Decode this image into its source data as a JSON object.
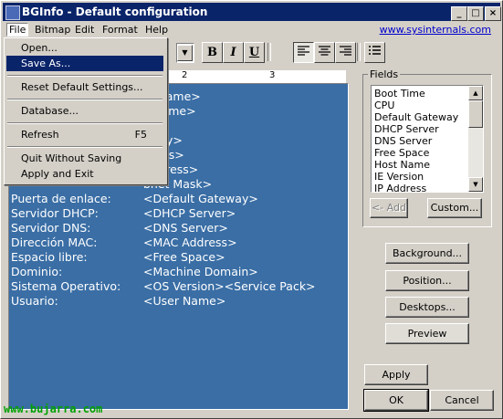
{
  "window": {
    "title": "BGInfo - Default configuration",
    "minimize_glyph": "_",
    "maximize_glyph": "□",
    "close_glyph": "×"
  },
  "menubar": {
    "items": [
      "File",
      "Bitmap",
      "Edit",
      "Format",
      "Help"
    ],
    "link": "www.sysinternals.com"
  },
  "file_menu": {
    "items": [
      {
        "label": "Open...",
        "shortcut": ""
      },
      {
        "label": "Save As...",
        "shortcut": ""
      },
      {
        "label": "Reset Default Settings...",
        "shortcut": ""
      },
      {
        "label": "Database...",
        "shortcut": ""
      },
      {
        "label": "Refresh",
        "shortcut": "F5"
      },
      {
        "label": "Quit Without Saving",
        "shortcut": ""
      },
      {
        "label": "Apply and Exit",
        "shortcut": ""
      }
    ]
  },
  "toolbar": {
    "bold": "B",
    "italic": "I",
    "underline": "U",
    "icons": [
      "align-left-icon",
      "align-center-icon",
      "align-right-icon",
      "bullet-list-icon"
    ]
  },
  "ruler": {
    "marks": [
      "2",
      "3"
    ]
  },
  "editor": {
    "lines": [
      {
        "label": "",
        "value": "st Name>"
      },
      {
        "label": "",
        "value": "ot Time>"
      },
      {
        "label": "",
        "value": "U>"
      },
      {
        "label": "",
        "value": "mory>"
      },
      {
        "label": "",
        "value": "umes>"
      },
      {
        "label": "",
        "value": "Address>"
      },
      {
        "label": "",
        "value": "bnet Mask>"
      },
      {
        "label": "Puerta de enlace:",
        "value": "<Default Gateway>"
      },
      {
        "label": "Servidor DHCP:",
        "value": "<DHCP Server>"
      },
      {
        "label": "Servidor DNS:",
        "value": "<DNS Server>"
      },
      {
        "label": "Dirección MAC:",
        "value": "<MAC Address>"
      },
      {
        "label": "Espacio libre:",
        "value": "<Free Space>"
      },
      {
        "label": "Dominio:",
        "value": "<Machine Domain>"
      },
      {
        "label": "Sistema Operativo:",
        "value": "<OS Version><Service Pack>"
      },
      {
        "label": "Usuario:",
        "value": "<User Name>"
      }
    ],
    "background": "#3a6ea5"
  },
  "fields": {
    "label": "Fields",
    "items": [
      "Boot Time",
      "CPU",
      "Default Gateway",
      "DHCP Server",
      "DNS Server",
      "Free Space",
      "Host Name",
      "IE Version",
      "IP Address"
    ],
    "add_button": "<- Add",
    "custom_button": "Custom..."
  },
  "buttons": {
    "background": "Background...",
    "position": "Position...",
    "desktops": "Desktops...",
    "preview": "Preview",
    "apply": "Apply",
    "ok": "OK",
    "cancel": "Cancel"
  },
  "watermark": "www.bujarra.com",
  "colors": {
    "titlebar": "#0a246a",
    "highlight": "#0a246a",
    "link": "#0000cc",
    "watermark": "#00a000"
  }
}
